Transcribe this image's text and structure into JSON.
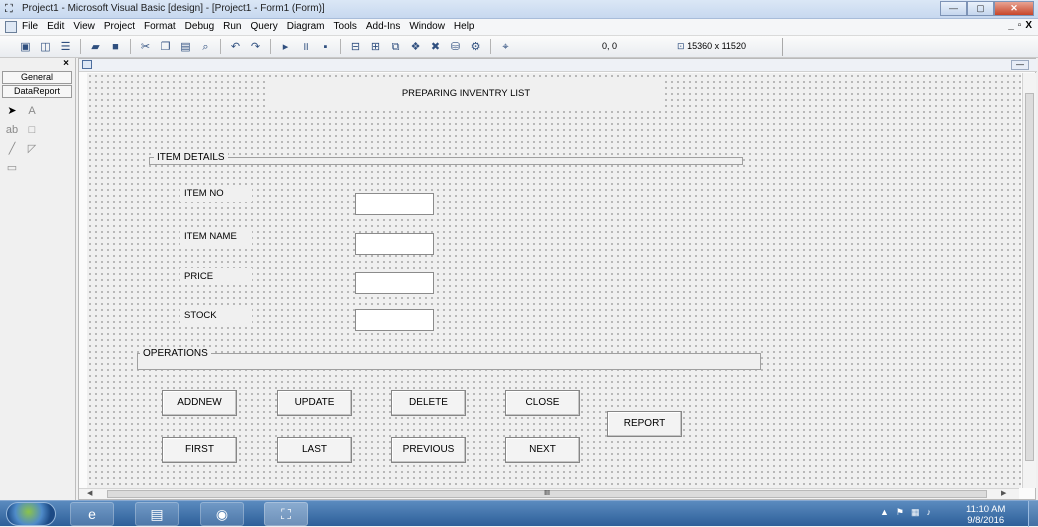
{
  "window": {
    "title": "Project1 - Microsoft Visual Basic [design] - [Project1 - Form1 (Form)]",
    "min": "—",
    "max": "▢",
    "close": "✕"
  },
  "menu": {
    "items": [
      "File",
      "Edit",
      "View",
      "Project",
      "Format",
      "Debug",
      "Run",
      "Query",
      "Diagram",
      "Tools",
      "Add-Ins",
      "Window",
      "Help"
    ],
    "mdi": [
      "_",
      "▫",
      "X"
    ]
  },
  "toolbar": {
    "position": "0, 0",
    "size": "15360 x 11520",
    "icons": [
      "add-project-icon",
      "add-form-icon",
      "menu-editor-icon",
      "open-project-icon",
      "save-project-icon",
      "cut-icon",
      "copy-icon",
      "paste-icon",
      "find-icon",
      "undo-icon",
      "redo-icon",
      "start-icon",
      "break-icon",
      "end-icon",
      "project-explorer-icon",
      "properties-window-icon",
      "form-layout-icon",
      "object-browser-icon",
      "toolbox-icon",
      "data-view-icon",
      "component-manager-icon"
    ]
  },
  "toolbox": {
    "close": "×",
    "tabs": [
      "General",
      "DataReport"
    ]
  },
  "form": {
    "title_label": "PREPARING INVENTRY LIST",
    "item_frame": "ITEM DETAILS",
    "fields": [
      {
        "label": "ITEM NO",
        "value": ""
      },
      {
        "label": "ITEM NAME",
        "value": ""
      },
      {
        "label": "PRICE",
        "value": ""
      },
      {
        "label": "STOCK",
        "value": ""
      }
    ],
    "ops_frame": "OPERATIONS",
    "buttons": {
      "addnew": "ADDNEW",
      "update": "UPDATE",
      "delete": "DELETE",
      "close": "CLOSE",
      "report": "REPORT",
      "first": "FIRST",
      "last": "LAST",
      "previous": "PREVIOUS",
      "next": "NEXT"
    }
  },
  "scrollbar": {
    "thumb_grip": "III"
  },
  "taskbar": {
    "time": "11:10 AM",
    "date": "9/8/2016"
  }
}
